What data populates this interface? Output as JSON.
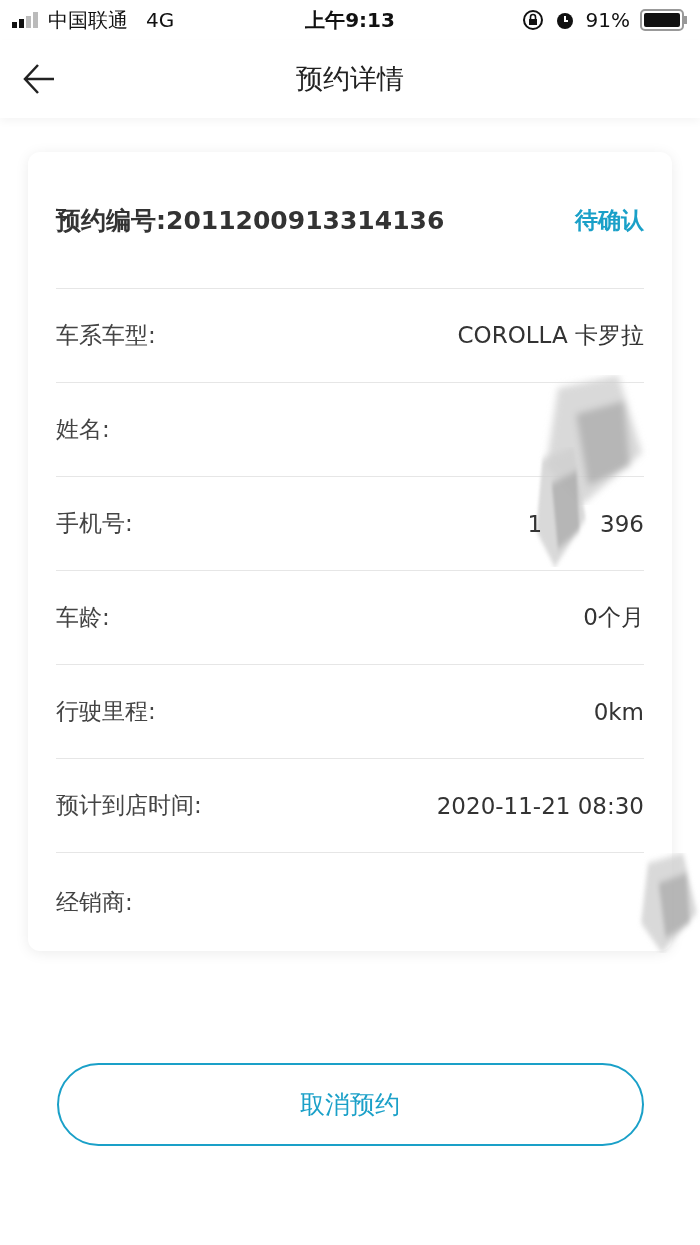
{
  "status_bar": {
    "carrier": "中国联通",
    "network": "4G",
    "time": "上午9:13",
    "battery": "91%"
  },
  "nav": {
    "title": "预约详情"
  },
  "card": {
    "order_label": "预约编号:2011200913314136",
    "status": "待确认",
    "rows": [
      {
        "label": "车系车型:",
        "value": "COROLLA 卡罗拉"
      },
      {
        "label": "姓名:",
        "redacted": true
      },
      {
        "label": "手机号:",
        "value_start": "1",
        "value_end": "396",
        "redacted": true
      },
      {
        "label": "车龄:",
        "value": "0个月"
      },
      {
        "label": "行驶里程:",
        "value": "0km"
      },
      {
        "label": "预计到店时间:",
        "value": "2020-11-21 08:30"
      },
      {
        "label": "经销商:",
        "redacted": true
      }
    ]
  },
  "cancel_button": "取消预约"
}
